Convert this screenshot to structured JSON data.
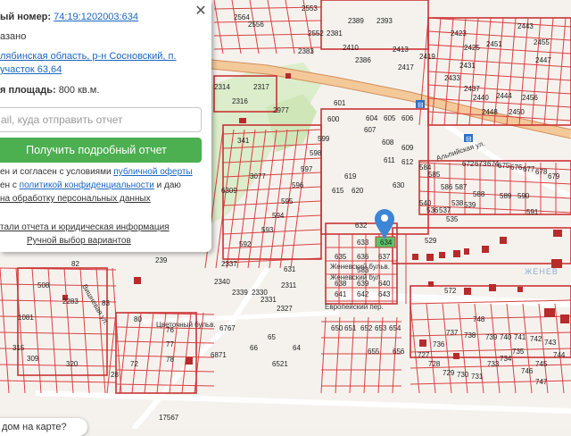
{
  "info_panel": {
    "cad_number_label": "ый номер:",
    "cad_number": "74:19:1202003:634",
    "status": "азано",
    "address_line1": "лябинская область, р-н Сосновский, п.",
    "address_line2": "участок 63,64",
    "area_label": "я площадь:",
    "area_value": "800 кв.м.",
    "email_placeholder": "ail, куда отправить отчет",
    "report_button": "Получить подробный отчет",
    "consent_line1_a": "ен и согласен с условиями",
    "consent_line1_link": "публичной оферты",
    "consent_line2_a": "ен с",
    "consent_line2_link": "политикой конфиденциальности",
    "consent_line2_b": "и даю",
    "consent_line3_link": "на обработку персональных данных",
    "details_link": "тали отчета и юридическая информация",
    "manual_link": "Ручной выбор вариантов",
    "close_glyph": "✕"
  },
  "bottom_pill": "дом на карте?",
  "map": {
    "marker_icon": "location-pin-icon",
    "roads": [
      "Женевский бульв.",
      "Женевский бул",
      "Европейский пер.",
      "Цветочный бульв.",
      "Альпийская ул.",
      "Вишневая ул."
    ],
    "district_label": "ЖЕНЕВ",
    "parcels": [
      "2564",
      "2556",
      "2553",
      "2389",
      "2393",
      "2552",
      "2381",
      "2410",
      "2383",
      "2386",
      "2413",
      "2419",
      "2417",
      "2423",
      "2425",
      "2451",
      "2455",
      "2443",
      "2447",
      "2431",
      "2433",
      "2440",
      "2444",
      "2437",
      "2448",
      "2456",
      "2450",
      "2314",
      "2317",
      "2316",
      "2977",
      "341",
      "601",
      "600",
      "604",
      "605",
      "606",
      "607",
      "608",
      "609",
      "611",
      "612",
      "672",
      "673",
      "674",
      "675",
      "676",
      "677",
      "678",
      "679",
      "598",
      "599",
      "597",
      "596",
      "595",
      "594",
      "593",
      "592",
      "615",
      "619",
      "620",
      "630",
      "631",
      "632",
      "633",
      "634",
      "635",
      "636",
      "637",
      "638",
      "639",
      "640",
      "641",
      "642",
      "643",
      "529",
      "572",
      "583",
      "584",
      "585",
      "586",
      "587",
      "588",
      "589",
      "590",
      "591",
      "535",
      "536",
      "537",
      "538",
      "539",
      "540",
      "6309",
      "3077",
      "2337",
      "2340",
      "2339",
      "2330",
      "2331",
      "2327",
      "2311",
      "239",
      "508",
      "2283",
      "1081",
      "315",
      "309",
      "320",
      "28",
      "72",
      "76",
      "77",
      "78",
      "80",
      "82",
      "83",
      "6871",
      "6767",
      "6521",
      "655",
      "656",
      "650",
      "651",
      "652",
      "653",
      "654",
      "64",
      "66",
      "65",
      "748",
      "737",
      "738",
      "736",
      "727",
      "728",
      "729",
      "730",
      "731",
      "733",
      "734",
      "735",
      "739",
      "740",
      "741",
      "742",
      "743",
      "744",
      "745",
      "746",
      "747",
      "17567"
    ]
  }
}
